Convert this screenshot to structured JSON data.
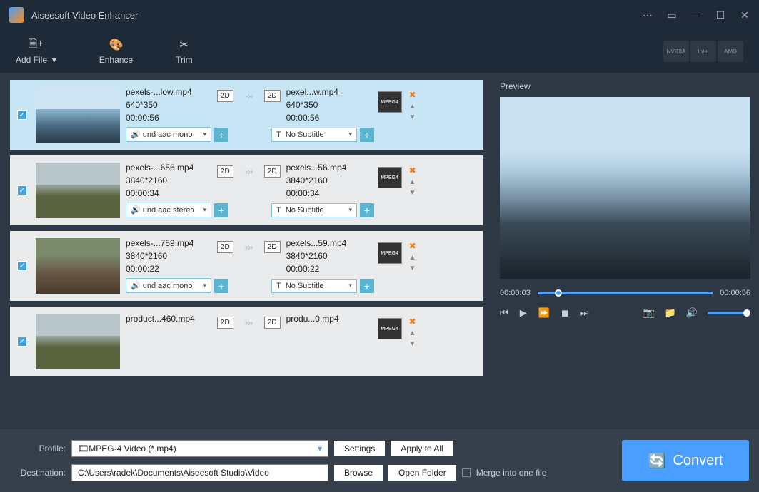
{
  "app": {
    "title": "Aiseesoft Video Enhancer"
  },
  "titlebar": {
    "minimize": "—",
    "close": "✕"
  },
  "toolbar": {
    "add_file": "Add File",
    "enhance": "Enhance",
    "trim": "Trim",
    "gpu": [
      "NVIDIA",
      "Intel",
      "AMD"
    ]
  },
  "files": [
    {
      "selected": true,
      "checked": true,
      "thumb": "snow",
      "src_name": "pexels-...low.mp4",
      "src_res": "640*350",
      "src_dur": "00:00:56",
      "dst_name": "pexel...w.mp4",
      "dst_res": "640*350",
      "dst_dur": "00:00:56",
      "audio": "und aac mono",
      "subtitle": "No Subtitle"
    },
    {
      "selected": false,
      "checked": true,
      "thumb": "field",
      "src_name": "pexels-...656.mp4",
      "src_res": "3840*2160",
      "src_dur": "00:00:34",
      "dst_name": "pexels...56.mp4",
      "dst_res": "3840*2160",
      "dst_dur": "00:00:34",
      "audio": "und aac stereo",
      "subtitle": "No Subtitle"
    },
    {
      "selected": false,
      "checked": true,
      "thumb": "ground",
      "src_name": "pexels-...759.mp4",
      "src_res": "3840*2160",
      "src_dur": "00:00:22",
      "dst_name": "pexels...59.mp4",
      "dst_res": "3840*2160",
      "dst_dur": "00:00:22",
      "audio": "und aac mono",
      "subtitle": "No Subtitle"
    },
    {
      "selected": false,
      "checked": true,
      "thumb": "field",
      "src_name": "product...460.mp4",
      "src_res": "",
      "src_dur": "",
      "dst_name": "produ...0.mp4",
      "dst_res": "",
      "dst_dur": "",
      "audio": "",
      "subtitle": ""
    }
  ],
  "badges": {
    "twod": "2D",
    "mpeg": "MPEG4"
  },
  "preview": {
    "label": "Preview",
    "cur_time": "00:00:03",
    "total_time": "00:00:56"
  },
  "bottom": {
    "profile_label": "Profile:",
    "profile_value": "MPEG-4 Video (*.mp4)",
    "settings": "Settings",
    "apply_all": "Apply to All",
    "dest_label": "Destination:",
    "dest_value": "C:\\Users\\radek\\Documents\\Aiseesoft Studio\\Video",
    "browse": "Browse",
    "open_folder": "Open Folder",
    "merge": "Merge into one file",
    "convert": "Convert"
  }
}
